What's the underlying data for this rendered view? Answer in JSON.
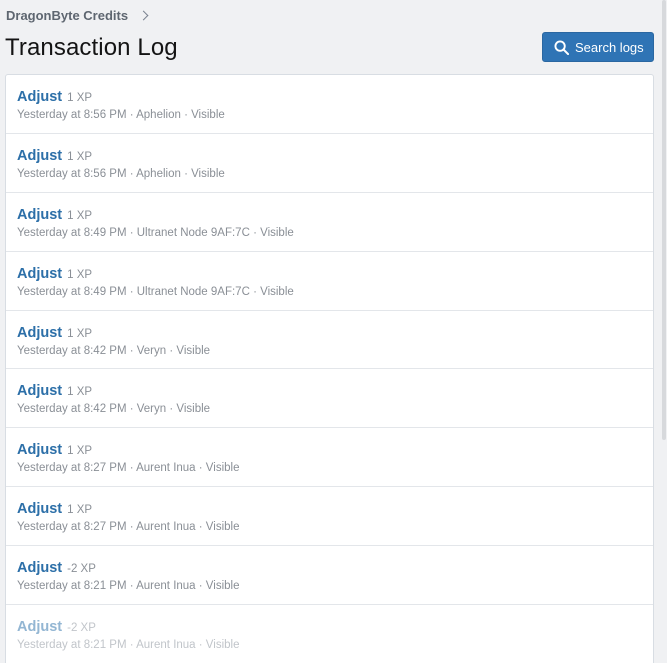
{
  "breadcrumb": {
    "label": "DragonByte Credits"
  },
  "page": {
    "title": "Transaction Log"
  },
  "toolbar": {
    "search_label": "Search logs"
  },
  "transactions": [
    {
      "action": "Adjust",
      "amount": "1 XP",
      "meta": "Yesterday at 8:56 PM · Aphelion · Visible"
    },
    {
      "action": "Adjust",
      "amount": "1 XP",
      "meta": "Yesterday at 8:56 PM · Aphelion · Visible"
    },
    {
      "action": "Adjust",
      "amount": "1 XP",
      "meta": "Yesterday at 8:49 PM · Ultranet Node 9AF:7C · Visible"
    },
    {
      "action": "Adjust",
      "amount": "1 XP",
      "meta": "Yesterday at 8:49 PM · Ultranet Node 9AF:7C · Visible"
    },
    {
      "action": "Adjust",
      "amount": "1 XP",
      "meta": "Yesterday at 8:42 PM · Veryn · Visible"
    },
    {
      "action": "Adjust",
      "amount": "1 XP",
      "meta": "Yesterday at 8:42 PM · Veryn · Visible"
    },
    {
      "action": "Adjust",
      "amount": "1 XP",
      "meta": "Yesterday at 8:27 PM · Aurent Inua · Visible"
    },
    {
      "action": "Adjust",
      "amount": "1 XP",
      "meta": "Yesterday at 8:27 PM · Aurent Inua · Visible"
    },
    {
      "action": "Adjust",
      "amount": "-2 XP",
      "meta": "Yesterday at 8:21 PM · Aurent Inua · Visible"
    },
    {
      "action": "Adjust",
      "amount": "-2 XP",
      "meta": "Yesterday at 8:21 PM · Aurent Inua · Visible"
    }
  ],
  "colors": {
    "accent": "#2f74b5",
    "link": "#2c6fa8",
    "muted": "#8a8f96"
  }
}
